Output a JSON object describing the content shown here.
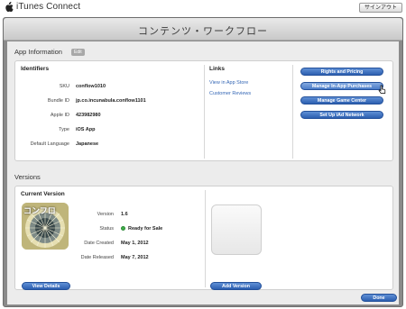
{
  "topbar": {
    "brand": "iTunes Connect",
    "signout_label": "サインアウト"
  },
  "header": {
    "title": "コンテンツ・ワークフロー"
  },
  "app_info": {
    "section_title": "App Information",
    "edit_label": "Edit",
    "identifiers": {
      "heading": "Identifiers",
      "rows": [
        {
          "label": "SKU",
          "value": "conflow1010"
        },
        {
          "label": "Bundle ID",
          "value": "jp.co.incunabula.conflow1101"
        },
        {
          "label": "Apple ID",
          "value": "423982980"
        },
        {
          "label": "Type",
          "value": "iOS App"
        },
        {
          "label": "Default Language",
          "value": "Japanese"
        }
      ]
    },
    "links": {
      "heading": "Links",
      "items": [
        "View in App Store",
        "Customer Reviews"
      ]
    },
    "actions": [
      "Rights and Pricing",
      "Manage In-App Purchases",
      "Manage Game Center",
      "Set Up iAd Network"
    ]
  },
  "versions": {
    "section_title": "Versions",
    "current": {
      "heading": "Current Version",
      "icon_text": "コンフロ",
      "rows": [
        {
          "label": "Version",
          "value": "1.6"
        },
        {
          "label": "Status",
          "value": "Ready for Sale"
        },
        {
          "label": "Date Created",
          "value": "May 1, 2012"
        },
        {
          "label": "Date Released",
          "value": "May 7, 2012"
        }
      ],
      "view_details_label": "View Details"
    },
    "add_version_label": "Add Version"
  },
  "footer": {
    "done_label": "Done"
  },
  "colors": {
    "button_blue": "#2c5fb0",
    "status_green": "#3fb04a",
    "link_blue": "#3567b5"
  },
  "icons": [
    "apple-logo-icon",
    "pointer-cursor-icon",
    "status-dot-icon"
  ]
}
